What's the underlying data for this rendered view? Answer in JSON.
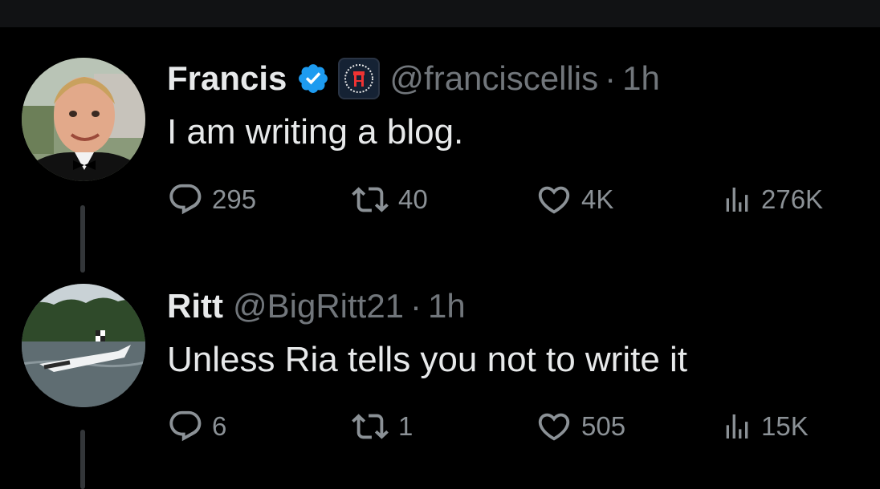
{
  "tweets": [
    {
      "name": "Francis",
      "verified": true,
      "affiliation": "barstool-badge",
      "handle": "@franciscellis",
      "separator": "·",
      "time": "1h",
      "text": "I am writing a blog.",
      "stats": {
        "replies": "295",
        "reposts": "40",
        "likes": "4K",
        "views": "276K"
      }
    },
    {
      "name": "Ritt",
      "verified": false,
      "handle": "@BigRitt21",
      "separator": "·",
      "time": "1h",
      "text": "Unless Ria tells you not to write it",
      "stats": {
        "replies": "6",
        "reposts": "1",
        "likes": "505",
        "views": "15K"
      }
    }
  ],
  "colors": {
    "background": "#000000",
    "text": "#e7e9ea",
    "muted": "#71767b",
    "verified": "#1d9bf0"
  },
  "icons": [
    "reply-icon",
    "repost-icon",
    "like-icon",
    "views-icon",
    "verified-badge-icon"
  ]
}
